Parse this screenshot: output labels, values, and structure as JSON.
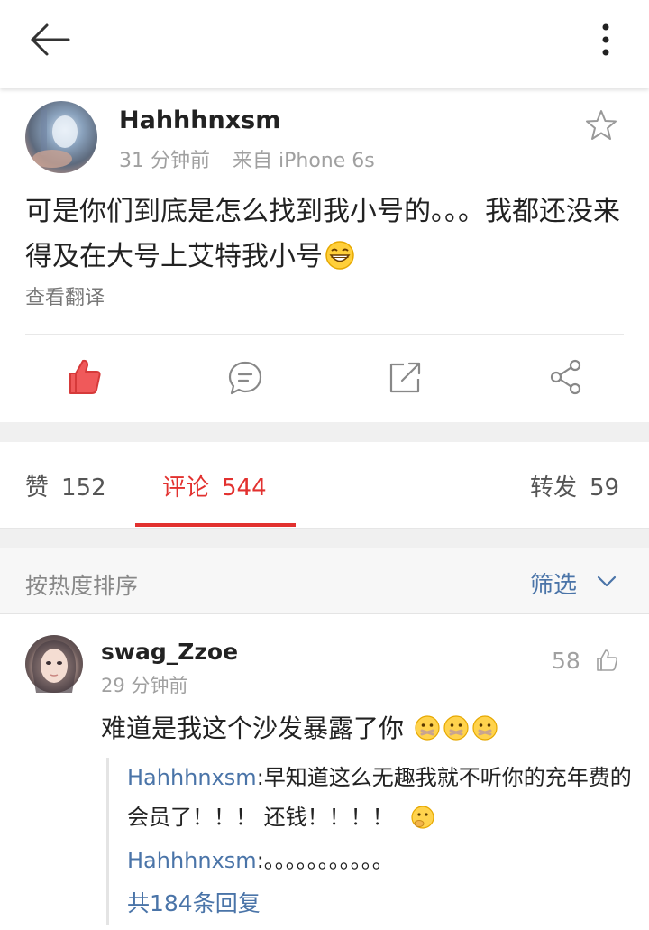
{
  "header": {
    "back_icon": "arrow-left-icon",
    "more_icon": "more-vertical-icon"
  },
  "post": {
    "author": "Hahhhnxsm",
    "time": "31 分钟前",
    "source": "来自 iPhone 6s",
    "text": "可是你们到底是怎么找到我小号的。。。我都还没来得及在大号上艾特我小号",
    "emoji": "grinning-emoji",
    "translate_label": "查看翻译",
    "favorite_icon": "star-icon",
    "actions": [
      "like-icon",
      "comment-icon",
      "repost-icon",
      "share-icon"
    ],
    "like_color": "#f0595a"
  },
  "tabs": {
    "likes": {
      "label": "赞",
      "count": "152"
    },
    "comments": {
      "label": "评论",
      "count": "544"
    },
    "reposts": {
      "label": "转发",
      "count": "59"
    },
    "accent": "#e2312f"
  },
  "sort": {
    "label": "按热度排序",
    "filter_label": "筛选"
  },
  "comment": {
    "user": "swag_Zzoe",
    "time": "29 分钟前",
    "likes": "58",
    "text": "难道是我这个沙发暴露了你",
    "emojis": [
      "shushing-emoji",
      "shushing-emoji",
      "shushing-emoji"
    ],
    "replies": [
      {
        "user": "Hahhhnxsm",
        "text": ":早知道这么无趣我就不听你的充年费的会员了！！！ 还钱！！！！"
      },
      {
        "user": "Hahhhnxsm",
        "text": ":。。。。。。。。。。。"
      }
    ],
    "more_replies": "共184条回复"
  },
  "colors": {
    "link": "#4a74a8",
    "muted": "#a0a0a0"
  }
}
